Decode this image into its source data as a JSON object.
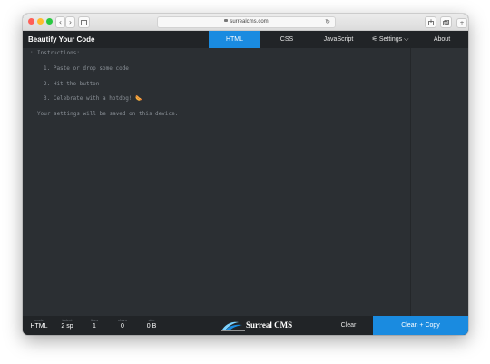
{
  "browser": {
    "url": "surrealcms.com",
    "back_icon": "chevron-left-icon",
    "forward_icon": "chevron-right-icon",
    "sidebar_icon": "sidebar-icon",
    "reload_icon": "reload-icon",
    "share_icon": "share-icon",
    "tabs_icon": "tabs-icon"
  },
  "app": {
    "title": "Beautify Your Code",
    "nav": [
      {
        "label": "HTML",
        "active": true
      },
      {
        "label": "CSS",
        "active": false
      },
      {
        "label": "JavaScript",
        "active": false
      },
      {
        "label": "⚟ Settings ⌵",
        "active": false
      },
      {
        "label": "About",
        "active": false
      }
    ]
  },
  "editor": {
    "gutter_mark": ":",
    "lines": [
      "Instructions:",
      "1. Paste or drop some code",
      "2. Hit the button",
      "3. Celebrate with a hotdog! 🌭",
      "Your settings will be saved on this device."
    ]
  },
  "footer": {
    "stats": [
      {
        "label": "mode",
        "value": "HTML"
      },
      {
        "label": "indent",
        "value": "2 sp"
      },
      {
        "label": "lines",
        "value": "1"
      },
      {
        "label": "chars",
        "value": "0"
      },
      {
        "label": "size",
        "value": "0 B"
      }
    ],
    "brand": "Surreal CMS",
    "clear_label": "Clear",
    "primary_label": "Clean + Copy"
  },
  "colors": {
    "accent": "#1a8be0",
    "editor_bg": "#2b2f33",
    "nav_bg": "#212427"
  }
}
